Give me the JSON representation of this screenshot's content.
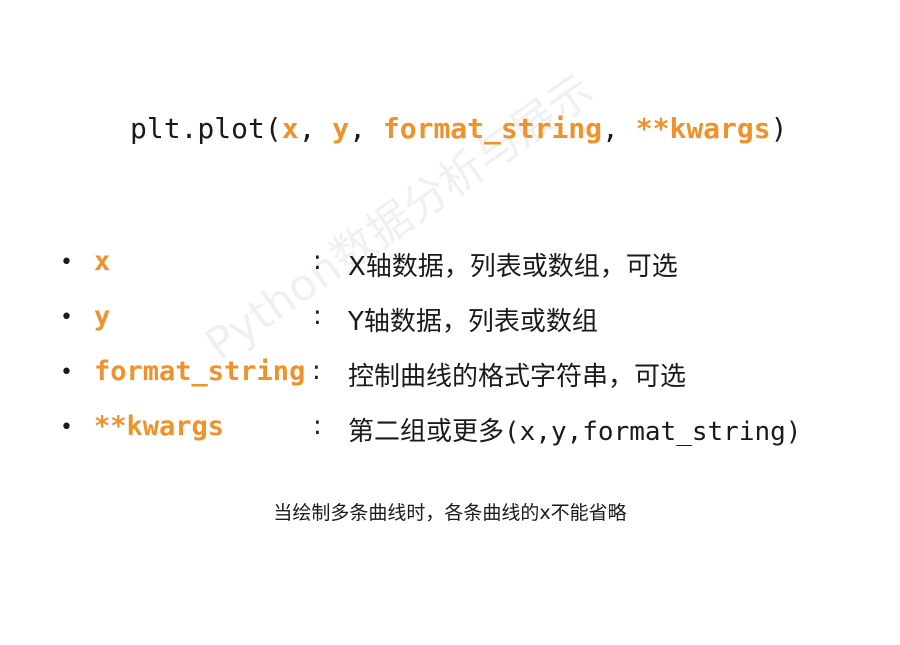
{
  "signature": {
    "prefix": "plt.plot(",
    "arg_x": "x",
    "sep1": ", ",
    "arg_y": "y",
    "sep2": ", ",
    "arg_format": "format_string",
    "sep3": ", ",
    "arg_kwargs": "**kwargs",
    "suffix": ")"
  },
  "params": [
    {
      "bullet": "•",
      "name": "x",
      "colon": ":",
      "desc": "X轴数据，列表或数组，可选",
      "desc_tail": ""
    },
    {
      "bullet": "•",
      "name": "y",
      "colon": ":",
      "desc": "Y轴数据，列表或数组",
      "desc_tail": ""
    },
    {
      "bullet": "•",
      "name": "format_string",
      "colon": ":",
      "desc": "控制曲线的格式字符串，可选",
      "desc_tail": ""
    },
    {
      "bullet": "•",
      "name": "**kwargs",
      "colon": ":",
      "desc": "第二组或更多",
      "desc_tail": "(x,y,format_string)"
    }
  ],
  "note": "当绘制多条曲线时，各条曲线的x不能省略",
  "watermark": "Python数据分析与展示",
  "colors": {
    "accent": "#f0922a",
    "text": "#1a1a1a"
  }
}
